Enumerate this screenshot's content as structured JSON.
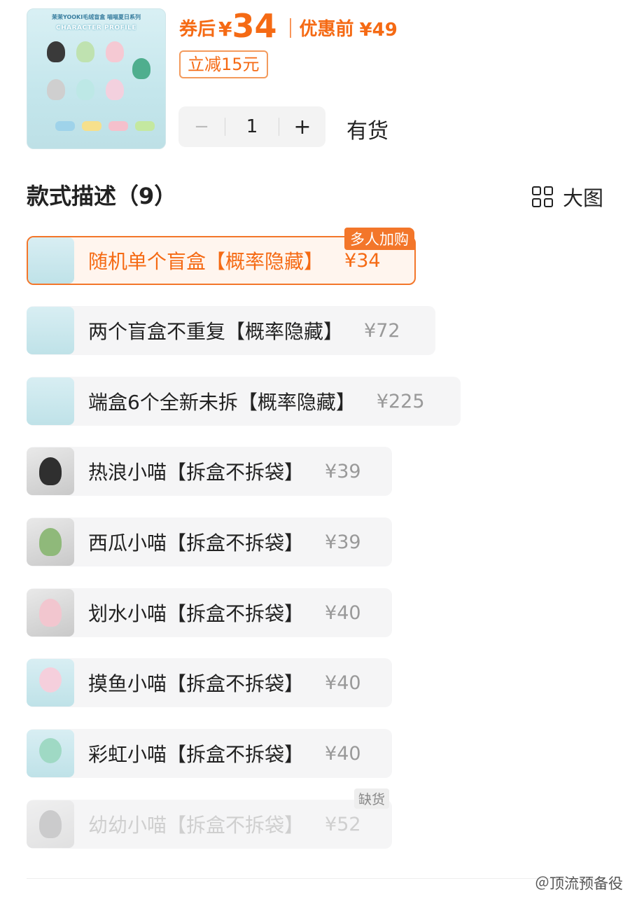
{
  "product": {
    "thumb_title": "茉茉YOOKI毛绒盲盒 喵喵夏日系列",
    "thumb_subtitle": "CHARACTER PROFILE",
    "coupon_label": "券后",
    "currency": "¥",
    "coupon_price": "34",
    "original_label": "优惠前",
    "original_price": "¥49",
    "discount_tag": "立减15元",
    "quantity": "1",
    "minus": "−",
    "plus": "+",
    "stock_status": "有货"
  },
  "section": {
    "title": "款式描述（9）",
    "view_label": "大图",
    "view_icon": "grid-icon"
  },
  "options": [
    {
      "name": "随机单个盲盒【概率隐藏】",
      "price": "¥34",
      "state": "selected",
      "badge": "多人加购",
      "image": "box-image"
    },
    {
      "name": "两个盲盒不重复【概率隐藏】",
      "price": "¥72",
      "state": "normal",
      "badge": "",
      "image": "box-image"
    },
    {
      "name": "端盒6个全新未拆【概率隐藏】",
      "price": "¥225",
      "state": "normal",
      "badge": "",
      "image": "box-image"
    },
    {
      "name": "热浪小喵【拆盒不拆袋】",
      "price": "¥39",
      "state": "normal",
      "badge": "",
      "image": "doll-photo"
    },
    {
      "name": "西瓜小喵【拆盒不拆袋】",
      "price": "¥39",
      "state": "normal",
      "badge": "",
      "image": "doll-photo"
    },
    {
      "name": "划水小喵【拆盒不拆袋】",
      "price": "¥40",
      "state": "normal",
      "badge": "",
      "image": "doll-photo"
    },
    {
      "name": "摸鱼小喵【拆盒不拆袋】",
      "price": "¥40",
      "state": "normal",
      "badge": "",
      "image": "card-image"
    },
    {
      "name": "彩虹小喵【拆盒不拆袋】",
      "price": "¥40",
      "state": "normal",
      "badge": "",
      "image": "card-image"
    },
    {
      "name": "幼幼小喵【拆盒不拆袋】",
      "price": "¥52",
      "state": "disabled",
      "badge": "缺货",
      "image": "doll-photo"
    }
  ],
  "watermark": "＠顶流预备役",
  "colors": {
    "accent": "#f56a14",
    "selected_border": "#f3762a",
    "option_bg": "#f5f5f6"
  }
}
